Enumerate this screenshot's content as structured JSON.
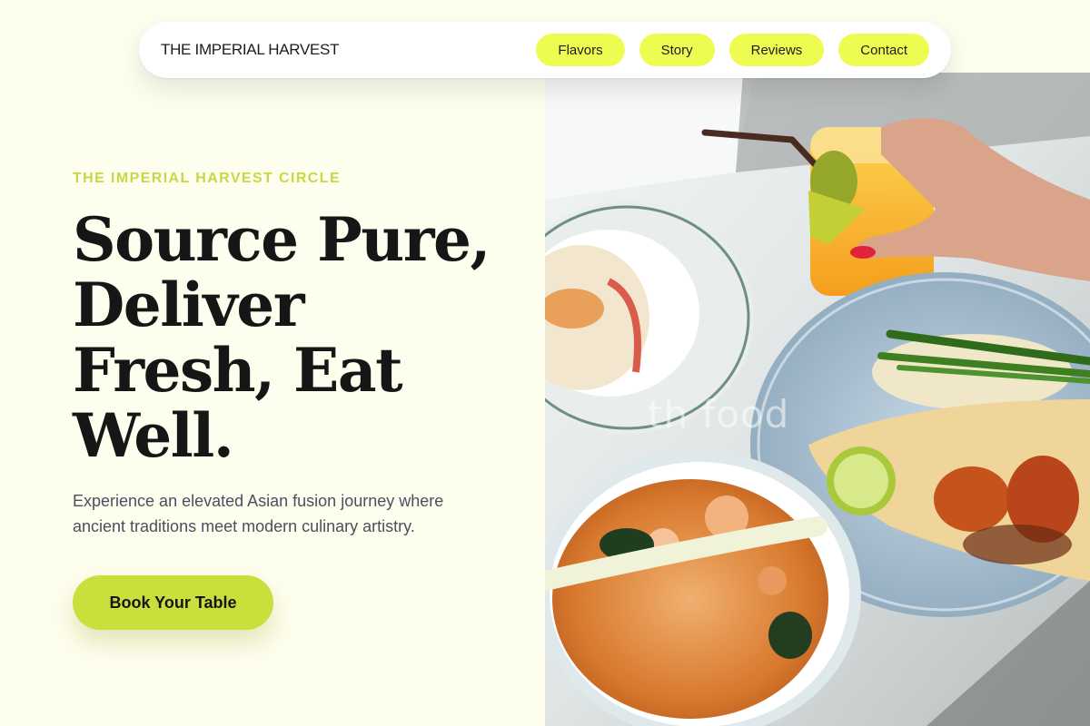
{
  "navbar": {
    "brand": "THE IMPERIAL HARVEST",
    "links": [
      {
        "label": "Flavors"
      },
      {
        "label": "Story"
      },
      {
        "label": "Reviews"
      },
      {
        "label": "Contact"
      }
    ]
  },
  "hero": {
    "eyebrow": "THE IMPERIAL HARVEST CIRCLE",
    "headline_lines": [
      "Source Pure,",
      "Deliver",
      "Fresh, Eat",
      "Well."
    ],
    "subtext": "Experience an elevated Asian fusion journey where ancient traditions meet modern culinary artistry.",
    "cta_label": "Book Your Table"
  },
  "photo": {
    "watermark": "th     food"
  },
  "colors": {
    "background": "#fefeee",
    "nav_pill": "#eefc52",
    "accent": "#cbdf3c",
    "eyebrow": "#c4d945",
    "heading": "#161616",
    "body_text": "#4a5060"
  }
}
